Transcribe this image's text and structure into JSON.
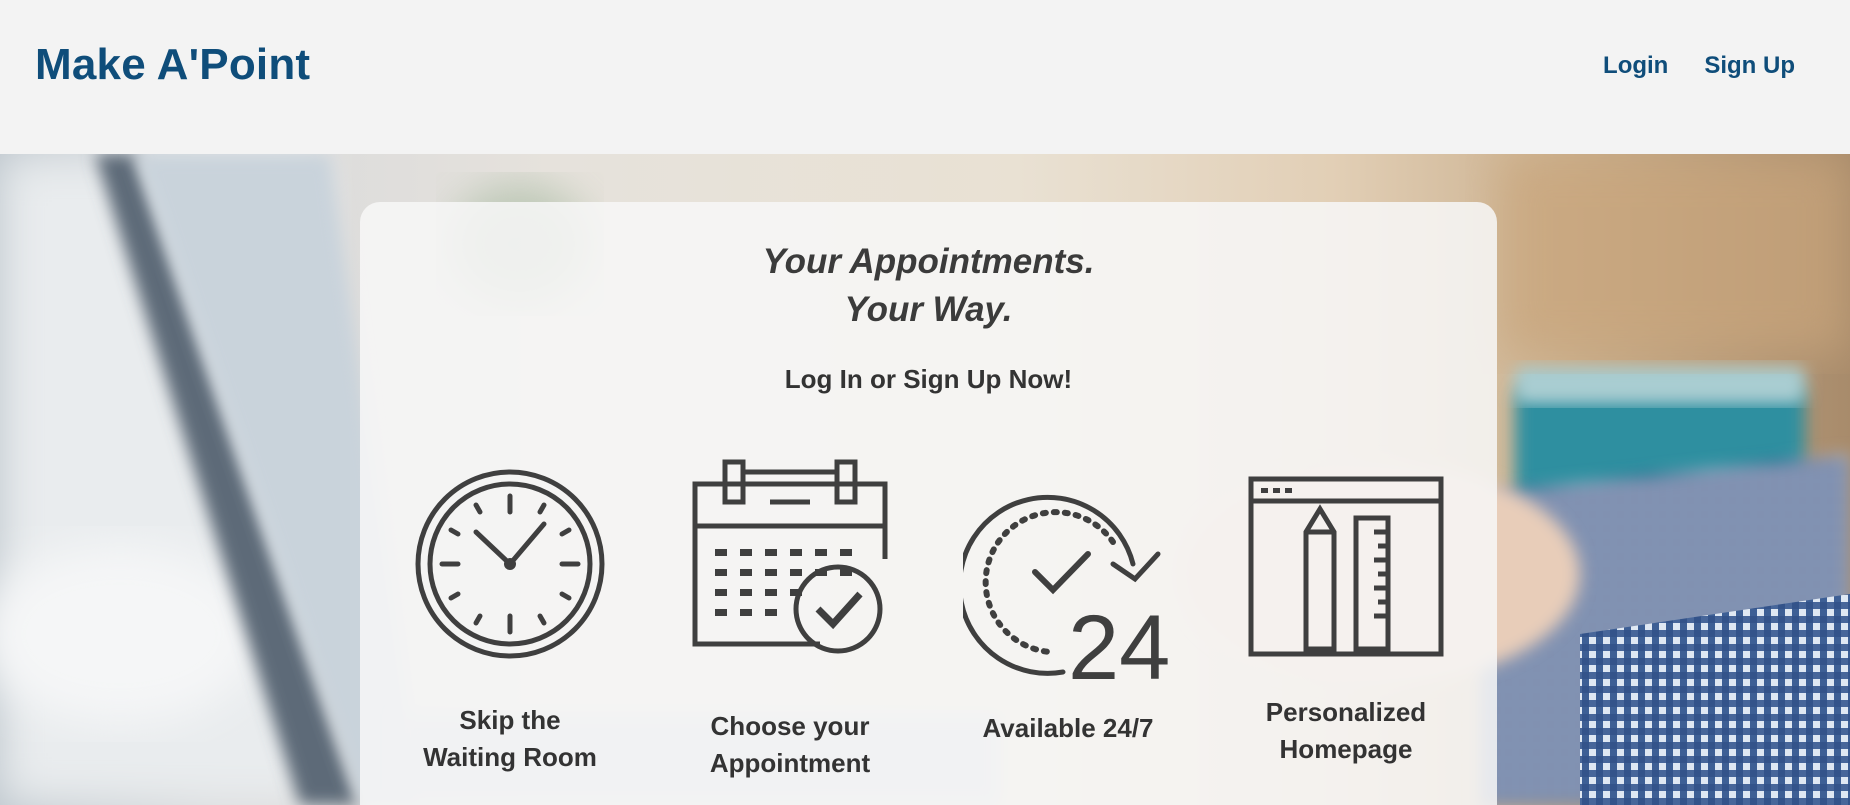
{
  "navbar": {
    "brand": "Make A'Point",
    "links": [
      {
        "label": "Login"
      },
      {
        "label": "Sign Up"
      }
    ]
  },
  "hero": {
    "headline_line1": "Your Appointments.",
    "headline_line2": "Your Way.",
    "subhead": "Log In or Sign Up Now!"
  },
  "features": [
    {
      "icon": "clock-icon",
      "label_line1": "Skip the",
      "label_line2": "Waiting Room"
    },
    {
      "icon": "calendar-check-icon",
      "label_line1": "Choose your",
      "label_line2": "Appointment"
    },
    {
      "icon": "available-24-7-icon",
      "label_line1": "Available 24/7",
      "label_line2": ""
    },
    {
      "icon": "personalized-homepage-icon",
      "label_line1": "Personalized",
      "label_line2": "Homepage"
    }
  ],
  "colors": {
    "brand": "#0f4d7a",
    "navbar_bg": "#f3f3f3",
    "text_dark": "#333333",
    "icon_stroke": "#3f3f3f"
  }
}
